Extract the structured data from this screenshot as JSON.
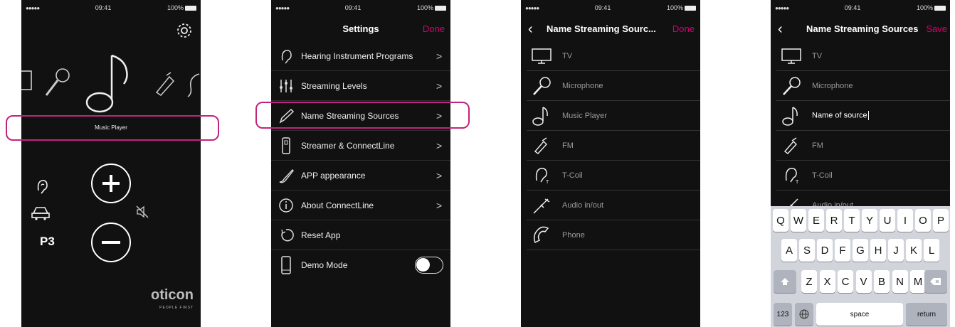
{
  "status": {
    "signal": "●●●●● ",
    "time": "09:41",
    "battery": "100%"
  },
  "colors": {
    "accent": "#d6006e",
    "highlight": "#c2237e"
  },
  "screen1": {
    "selected_source": "Music Player",
    "program": "P3",
    "brand": "oticon",
    "brand_tagline": "PEOPLE FIRST",
    "icons": [
      "gear-icon",
      "tv-icon",
      "microphone-icon",
      "music-note-icon",
      "fm-icon",
      "tcoil-icon",
      "ear-icon",
      "car-icon",
      "volume-up-icon",
      "volume-down-icon",
      "mute-icon"
    ]
  },
  "screen2": {
    "title": "Settings",
    "done": "Done",
    "items": [
      {
        "label": "Hearing Instrument Programs",
        "icon": "ear-icon"
      },
      {
        "label": "Streaming Levels",
        "icon": "sliders-icon"
      },
      {
        "label": "Name Streaming Sources",
        "icon": "pencil-icon"
      },
      {
        "label": "Streamer & ConnectLine",
        "icon": "streamer-icon"
      },
      {
        "label": "APP appearance",
        "icon": "brush-icon"
      },
      {
        "label": "About ConnectLine",
        "icon": "info-icon"
      },
      {
        "label": "Reset App",
        "icon": "reset-icon"
      },
      {
        "label": "Demo Mode",
        "icon": "phone-device-icon"
      }
    ],
    "demo_mode_on": false
  },
  "screen3": {
    "title": "Name Streaming Sourc...",
    "done": "Done",
    "sources": [
      {
        "label": "TV",
        "icon": "tv-icon"
      },
      {
        "label": "Microphone",
        "icon": "microphone-icon"
      },
      {
        "label": "Music Player",
        "icon": "music-note-icon"
      },
      {
        "label": "FM",
        "icon": "fm-icon"
      },
      {
        "label": "T-Coil",
        "icon": "tcoil-icon"
      },
      {
        "label": "Audio in/out",
        "icon": "audio-jack-icon"
      },
      {
        "label": "Phone",
        "icon": "phone-icon"
      }
    ]
  },
  "screen4": {
    "title": "Name Streaming Sources",
    "save": "Save",
    "sources": [
      {
        "label": "TV"
      },
      {
        "label": "Microphone"
      },
      {
        "label": "Name of source"
      },
      {
        "label": "FM"
      },
      {
        "label": "T-Coil"
      },
      {
        "label": "Audio in/out"
      }
    ],
    "keyboard": {
      "row1": [
        "Q",
        "W",
        "E",
        "R",
        "T",
        "Y",
        "U",
        "I",
        "O",
        "P"
      ],
      "row2": [
        "A",
        "S",
        "D",
        "F",
        "G",
        "H",
        "J",
        "K",
        "L"
      ],
      "row3": [
        "Z",
        "X",
        "C",
        "V",
        "B",
        "N",
        "M"
      ],
      "numbers": "123",
      "space": "space",
      "return": "return"
    }
  }
}
